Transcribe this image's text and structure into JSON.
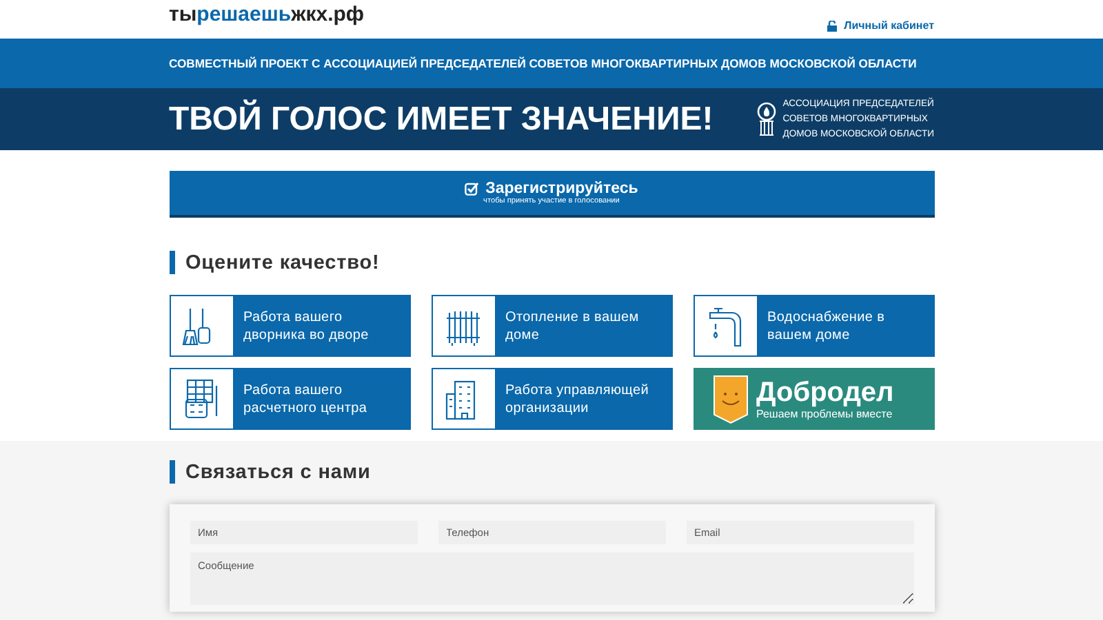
{
  "header": {
    "logo": [
      {
        "text": "ты",
        "accent": false
      },
      {
        "text": "решаешь",
        "accent": true
      },
      {
        "text": "жкх.рф",
        "accent": false
      }
    ],
    "account_link": "Личный кабинет"
  },
  "project_banner": "СОВМЕСТНЫЙ ПРОЕКТ С АССОЦИАЦИЕЙ ПРЕДСЕДАТЕЛЕЙ СОВЕТОВ МНОГОКВАРТИРНЫХ ДОМОВ МОСКОВСКОЙ ОБЛАСТИ",
  "hero": {
    "title": "ТВОЙ ГОЛОС ИМЕЕТ ЗНАЧЕНИЕ!",
    "association": [
      "АССОЦИАЦИЯ ПРЕДСЕДАТЕЛЕЙ",
      "СОВЕТОВ МНОГОКВАРТИРНЫХ",
      "ДОМОВ МОСКОВСКОЙ ОБЛАСТИ"
    ]
  },
  "register": {
    "title": "Зарегистрируйтесь",
    "subtitle": "чтобы принять участие в голосовании"
  },
  "quality": {
    "heading": "Оцените качество!",
    "tiles": [
      {
        "kind": "service",
        "label": "Работа вашего дворника во дворе"
      },
      {
        "kind": "service",
        "label": "Отопление в вашем доме"
      },
      {
        "kind": "service",
        "label": "Водоснабжение в вашем доме"
      },
      {
        "kind": "service",
        "label": "Работа вашего расчетного центра"
      },
      {
        "kind": "service",
        "label": "Работа управляющей организации"
      },
      {
        "kind": "promo",
        "title": "Добродел",
        "subtitle": "Решаем проблемы вместе"
      }
    ]
  },
  "contact": {
    "heading": "Связаться с нами",
    "fields": [
      {
        "placeholder": "Имя"
      },
      {
        "placeholder": "Телефон"
      },
      {
        "placeholder": "Email"
      }
    ],
    "message": {
      "placeholder": "Сообщение"
    }
  }
}
